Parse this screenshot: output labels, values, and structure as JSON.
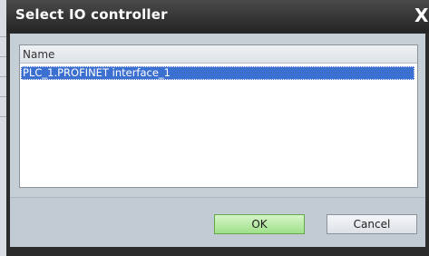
{
  "dialog": {
    "title": "Select IO controller",
    "close_glyph": "X"
  },
  "list": {
    "column_header": "Name",
    "rows": [
      "PLC_1.PROFINET interface_1"
    ],
    "selected_index": 0
  },
  "buttons": {
    "ok_label": "OK",
    "cancel_label": "Cancel"
  },
  "icons": {
    "close": "close-icon"
  },
  "colors": {
    "title_bar": "#2d2d2d",
    "selection": "#3b6fd0",
    "ok_button": "#a8e394",
    "dialog_body": "#c6cfd6"
  }
}
